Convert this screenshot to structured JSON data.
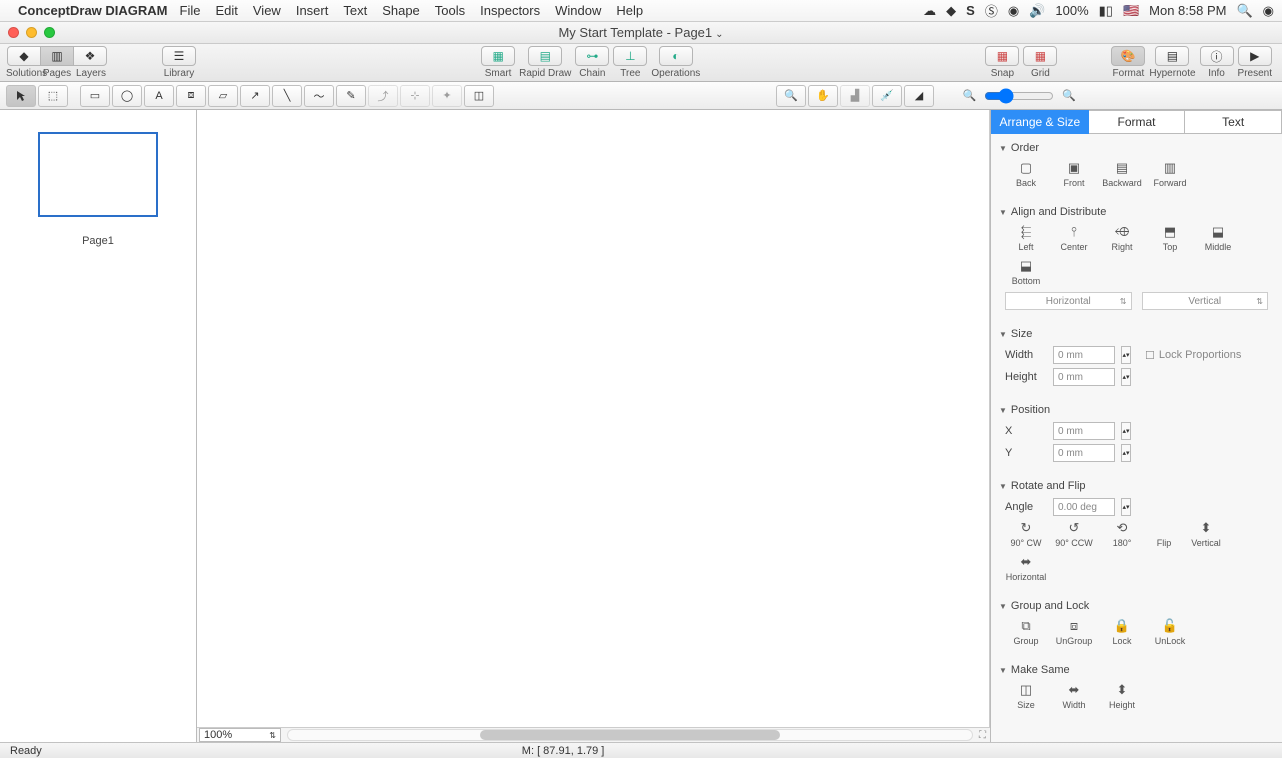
{
  "menubar": {
    "appname": "ConceptDraw DIAGRAM",
    "items": [
      "File",
      "Edit",
      "View",
      "Insert",
      "Text",
      "Shape",
      "Tools",
      "Inspectors",
      "Window",
      "Help"
    ],
    "battery": "100%",
    "clock": "Mon 8:58 PM"
  },
  "titlebar": {
    "title": "My Start Template - Page1"
  },
  "toolbar": {
    "solutions": "Solutions",
    "pages": "Pages",
    "layers": "Layers",
    "library": "Library",
    "smart": "Smart",
    "rapid": "Rapid Draw",
    "chain": "Chain",
    "tree": "Tree",
    "operations": "Operations",
    "snap": "Snap",
    "grid": "Grid",
    "format": "Format",
    "hypernote": "Hypernote",
    "info": "Info",
    "present": "Present"
  },
  "pagepanel": {
    "page1": "Page1"
  },
  "inspector": {
    "tabs": {
      "arrange": "Arrange & Size",
      "format": "Format",
      "text": "Text"
    },
    "order": {
      "title": "Order",
      "back": "Back",
      "front": "Front",
      "backward": "Backward",
      "forward": "Forward"
    },
    "align": {
      "title": "Align and Distribute",
      "left": "Left",
      "center": "Center",
      "right": "Right",
      "top": "Top",
      "middle": "Middle",
      "bottom": "Bottom",
      "horizontal": "Horizontal",
      "vertical": "Vertical"
    },
    "size": {
      "title": "Size",
      "width": "Width",
      "height": "Height",
      "wval": "0 mm",
      "hval": "0 mm",
      "lock": "Lock Proportions"
    },
    "position": {
      "title": "Position",
      "x": "X",
      "y": "Y",
      "xval": "0 mm",
      "yval": "0 mm"
    },
    "rotate": {
      "title": "Rotate and Flip",
      "angle": "Angle",
      "aval": "0.00 deg",
      "cw": "90° CW",
      "ccw": "90° CCW",
      "d180": "180°",
      "flip": "Flip",
      "vert": "Vertical",
      "horiz": "Horizontal"
    },
    "group": {
      "title": "Group and Lock",
      "group": "Group",
      "ungroup": "UnGroup",
      "lock": "Lock",
      "unlock": "UnLock"
    },
    "same": {
      "title": "Make Same",
      "size": "Size",
      "width": "Width",
      "height": "Height"
    }
  },
  "statusbar": {
    "ready": "Ready",
    "mouse": "M: [ 87.91, 1.79 ]",
    "zoom": "100%"
  }
}
